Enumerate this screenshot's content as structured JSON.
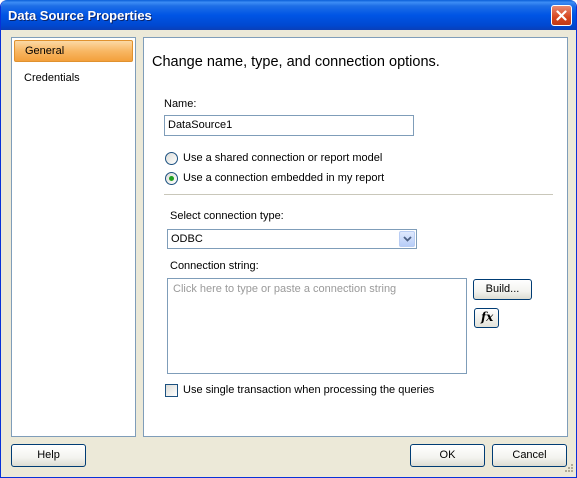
{
  "window": {
    "title": "Data Source Properties"
  },
  "nav": {
    "items": [
      {
        "label": "General",
        "selected": true
      },
      {
        "label": "Credentials",
        "selected": false
      }
    ]
  },
  "general": {
    "heading": "Change name, type, and connection options.",
    "name_label": "Name:",
    "name_value": "DataSource1",
    "radio_shared_label": "Use a shared connection or report model",
    "radio_embedded_label": "Use a connection embedded in my report",
    "selected_option": "embedded",
    "connection_type_label": "Select connection type:",
    "connection_type_value": "ODBC",
    "connection_string_label": "Connection string:",
    "connection_string_placeholder": "Click here to type or paste a connection string",
    "build_button_label": "Build...",
    "expression_button_label": "fx",
    "single_transaction_label": "Use single transaction when processing the queries",
    "single_transaction_checked": false
  },
  "footer": {
    "help_label": "Help",
    "ok_label": "OK",
    "cancel_label": "Cancel"
  },
  "colors": {
    "title_bar": "#0055e5",
    "dialog_bg": "#ece9d8",
    "selected_item": "#f8b764",
    "radio_dot": "#21a121"
  }
}
